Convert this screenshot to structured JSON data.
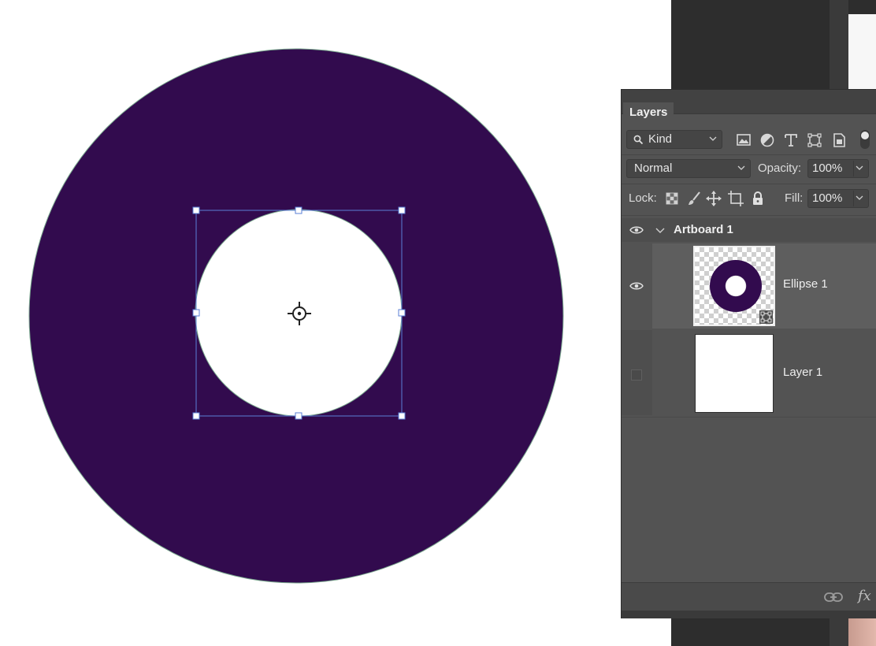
{
  "panel": {
    "tab_label": "Layers",
    "filter": {
      "value": "Kind",
      "icon": "search-icon"
    },
    "filter_icons": [
      "image-filter-icon",
      "adjustment-filter-icon",
      "type-filter-icon",
      "shape-filter-icon",
      "smart-object-filter-icon",
      "filter-toggle-icon"
    ],
    "blend_mode": "Normal",
    "opacity_label": "Opacity:",
    "opacity_value": "100%",
    "lock_label": "Lock:",
    "lock_icons": [
      "lock-transparent-pixels-icon",
      "lock-image-pixels-icon",
      "lock-position-icon",
      "lock-artboard-icon",
      "lock-all-icon"
    ],
    "fill_label": "Fill:",
    "fill_value": "100%",
    "layers": [
      {
        "name": "Artboard 1",
        "type": "artboard",
        "visible": true,
        "expanded": true
      },
      {
        "name": "Ellipse 1",
        "type": "shape",
        "visible": true,
        "selected": true
      },
      {
        "name": "Layer 1",
        "type": "pixel",
        "visible": false,
        "selected": false
      }
    ],
    "footer_icons": [
      "link-layers-icon",
      "fx-icon"
    ],
    "fx_label": "fx"
  },
  "canvas": {
    "shape_color": "#320b4e",
    "selection_color": "#5b7fd6",
    "center_icon": "crosshair-icon"
  }
}
